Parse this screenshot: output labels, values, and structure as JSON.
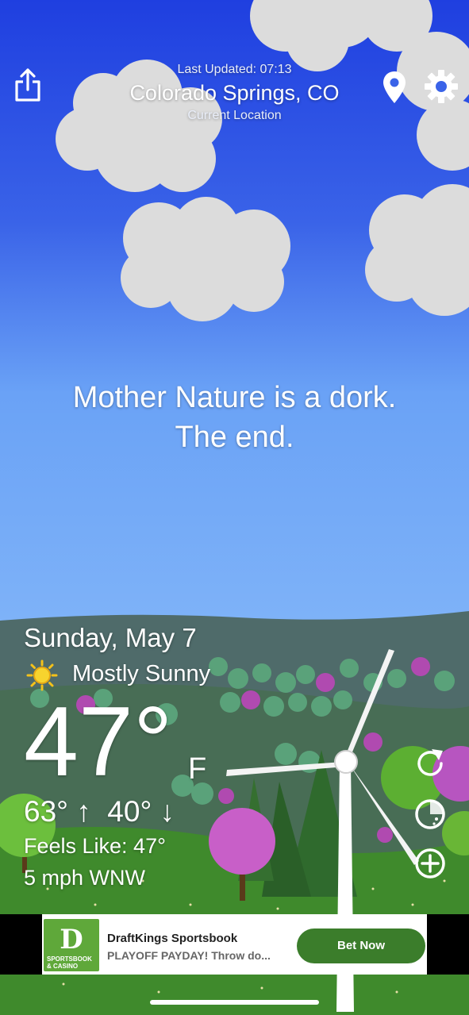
{
  "header": {
    "last_updated": "Last Updated: 07:13",
    "location": "Colorado Springs, CO",
    "location_sub": "Current Location"
  },
  "icons": {
    "share": "share-icon",
    "pin": "location-pin-icon",
    "settings": "gear-icon",
    "refresh": "refresh-icon",
    "radar": "radar-icon",
    "add": "add-icon",
    "sun": "sun-icon"
  },
  "message": {
    "line1": "Mother Nature is a dork.",
    "line2": "The end."
  },
  "weather": {
    "date": "Sunday, May 7",
    "condition": "Mostly Sunny",
    "temperature": "47°",
    "unit": "F",
    "high_low": "63° ↑  40° ↓",
    "feels_like": "Feels Like: 47°",
    "wind": "5 mph WNW"
  },
  "ad": {
    "title": "DraftKings Sportsbook",
    "body": "PLAYOFF PAYDAY! Throw do...",
    "cta": "Bet Now",
    "logo_mark": "D",
    "logo_line1": "SPORTSBOOK",
    "logo_line2": "& CASINO"
  },
  "colors": {
    "sky_top": "#2046e0",
    "sky_bottom": "#6fa5f7",
    "grass": "#3f8a2c",
    "cta_green": "#3b7d2b"
  }
}
